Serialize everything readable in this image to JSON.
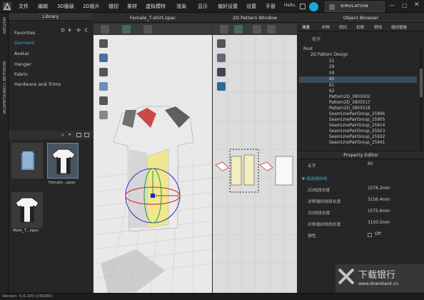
{
  "menu": [
    "文件",
    "编辑",
    "3D服装",
    "2D板片",
    "缝纫",
    "素材",
    "虚拟模特",
    "渲染",
    "显示",
    "偏好设置",
    "设置",
    "手册"
  ],
  "user": "Hello,",
  "simulation": "SIMULATION",
  "sidebar": [
    "HISTORY",
    "MODULAR CONFIGURATOR"
  ],
  "library": {
    "title": "Library",
    "items": [
      "Favorites",
      "Garment",
      "Avatar",
      "Hanger",
      "Fabric",
      "Hardware and Trims"
    ],
    "thumbs": [
      "",
      "Female...zpac",
      "Male_T...zpac"
    ]
  },
  "viewport3d": {
    "title": "Female_T-shirt.zpac"
  },
  "viewport2d": {
    "title": "2D Pattern Window"
  },
  "object_browser": {
    "title": "Object Browser",
    "tabs": [
      "场景",
      "织物",
      "纽扣",
      "扣眼",
      "明线",
      "缝纫褶皱"
    ],
    "col_label": "名字",
    "tree": [
      "Root",
      "2D Pattern Design",
      "21",
      "29",
      "59",
      "60",
      "61",
      "62",
      "Pattern2D_3805002",
      "Pattern2D_3805017",
      "Pattern2D_3805018",
      "SeamLinePairGroup_25896",
      "SeamLinePairGroup_25905",
      "SeamLinePairGroup_25914",
      "SeamLinePairGroup_25923",
      "SeamLinePairGroup_25932",
      "SeamLinePairGroup_25941"
    ],
    "selected": "60"
  },
  "property_editor": {
    "title": "Property Editor",
    "rows": [
      {
        "k": "名字",
        "v": "60"
      },
      {
        "k": "▼ 纸选择的线",
        "v": ""
      },
      {
        "k": "2D线段长度",
        "v": "1578.2mm"
      },
      {
        "k": "对称缝纫线段长度",
        "v": "3156.4mm"
      },
      {
        "k": "3D线段长度",
        "v": "1575.6mm"
      },
      {
        "k": "对称缝纫线段长度",
        "v": "3150.5mm"
      },
      {
        "k": "弹性",
        "v": "Off"
      }
    ]
  },
  "status": "Version: 5.0.100 (r38265)",
  "watermark": {
    "cn": "下载银行",
    "url": "www.downbank.cn"
  },
  "colors": {
    "accent": "#2fb0e0",
    "sim": "#18a8d8",
    "selected": "#3b4b5c"
  }
}
